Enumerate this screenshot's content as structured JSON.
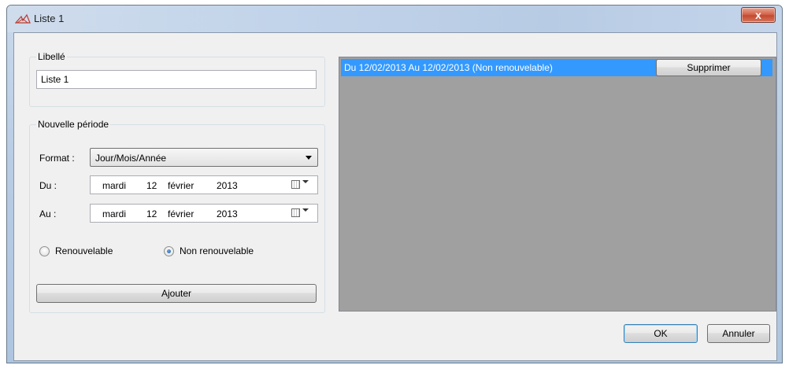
{
  "window": {
    "title": "Liste 1",
    "close_label": "x"
  },
  "libelle": {
    "legend": "Libellé",
    "value": "Liste 1"
  },
  "periode": {
    "legend": "Nouvelle période",
    "format_label": "Format :",
    "format_value": "Jour/Mois/Année",
    "du_label": "Du :",
    "du_date": {
      "day_name": "mardi",
      "day": "12",
      "month": "février",
      "year": "2013"
    },
    "au_label": "Au :",
    "au_date": {
      "day_name": "mardi",
      "day": "12",
      "month": "février",
      "year": "2013"
    },
    "radio_renouvelable": "Renouvelable",
    "radio_non_renouvelable": "Non renouvelable",
    "selected": "Non renouvelable",
    "add_button": "Ajouter"
  },
  "periods_list": {
    "items": [
      {
        "text": "Du 12/02/2013 Au 12/02/2013 (Non renouvelable)",
        "delete_label": "Supprimer"
      }
    ],
    "selected_color": "#3399ff",
    "background_color": "#a0a0a0"
  },
  "footer": {
    "ok": "OK",
    "cancel": "Annuler"
  }
}
